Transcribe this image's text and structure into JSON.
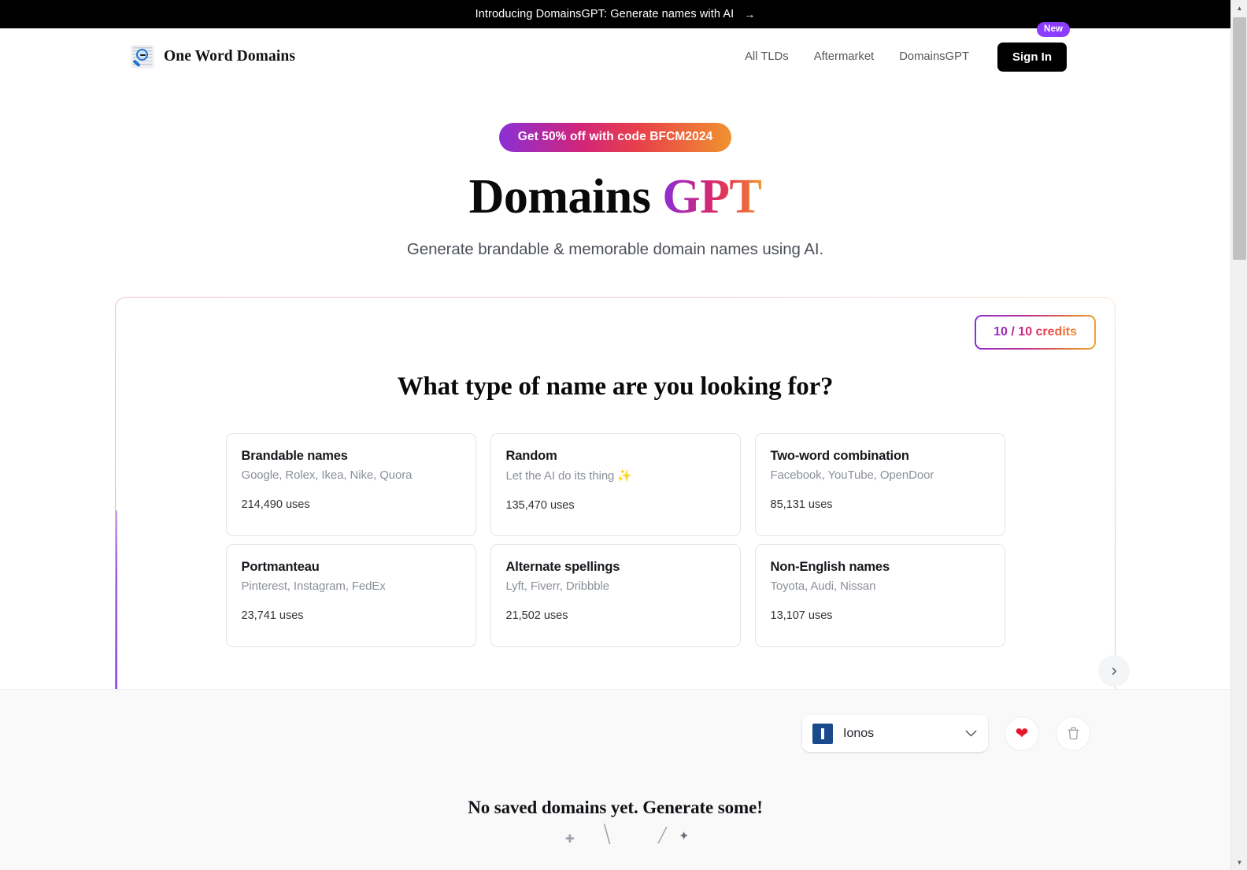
{
  "announcement": {
    "text": "Introducing DomainsGPT: Generate names with AI",
    "arrow": "→"
  },
  "header": {
    "brand": "One Word Domains",
    "logo_icon": "magnifying-glass-icon",
    "nav": [
      {
        "label": "All TLDs"
      },
      {
        "label": "Aftermarket"
      },
      {
        "label": "DomainsGPT",
        "badge": "New"
      }
    ],
    "sign_in": "Sign In"
  },
  "hero": {
    "promo": "Get 50% off with code BFCM2024",
    "title_plain": "Domains",
    "title_accent": "GPT",
    "subtitle": "Generate brandable & memorable domain names using AI."
  },
  "panel": {
    "credits": "10 / 10 credits",
    "question": "What type of name are you looking for?",
    "next_icon": "chevron-right-icon",
    "cards": [
      {
        "title": "Brandable names",
        "examples": "Google, Rolex, Ikea, Nike, Quora",
        "uses": "214,490 uses"
      },
      {
        "title": "Random",
        "examples": "Let the AI do its thing ✨",
        "uses": "135,470 uses"
      },
      {
        "title": "Two-word combination",
        "examples": "Facebook, YouTube, OpenDoor",
        "uses": "85,131 uses"
      },
      {
        "title": "Portmanteau",
        "examples": "Pinterest, Instagram, FedEx",
        "uses": "23,741 uses"
      },
      {
        "title": "Alternate spellings",
        "examples": "Lyft, Fiverr, Dribbble",
        "uses": "21,502 uses"
      },
      {
        "title": "Non-English names",
        "examples": "Toyota, Audi, Nissan",
        "uses": "13,107 uses"
      }
    ]
  },
  "saved": {
    "registrar": "Ionos",
    "registrar_logo": "ionos-logo-icon",
    "chevron": "⌄",
    "favorite_icon": "heart-icon",
    "delete_icon": "trash-icon",
    "empty_message": "No saved domains yet. Generate some!"
  },
  "colors": {
    "accent_purple": "#8b3dff",
    "gradient_start": "#8b2fd6",
    "gradient_mid": "#d1257a",
    "gradient_end": "#f0922f",
    "heart_red": "#e8152a",
    "banner_bg": "#000000",
    "saved_bg": "#f9f9fa"
  }
}
